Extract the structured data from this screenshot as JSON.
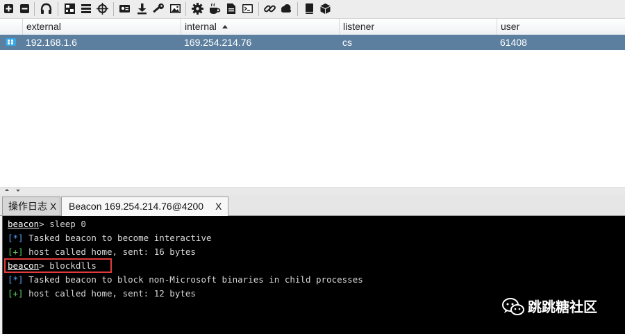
{
  "toolbar": {
    "buttons": [
      {
        "name": "new-connection-icon"
      },
      {
        "name": "disconnect-icon"
      },
      {
        "name": "listeners-headphones-icon"
      },
      {
        "name": "pivot-graph-icon"
      },
      {
        "name": "session-table-icon"
      },
      {
        "name": "targets-crosshair-icon"
      },
      {
        "name": "credentials-icon"
      },
      {
        "name": "downloads-icon"
      },
      {
        "name": "keystrokes-key-icon"
      },
      {
        "name": "screenshots-image-icon"
      },
      {
        "name": "settings-gear-icon"
      },
      {
        "name": "web-drive-by-cup-icon"
      },
      {
        "name": "document-icon"
      },
      {
        "name": "script-console-icon"
      },
      {
        "name": "link-icon"
      },
      {
        "name": "cloud-icon"
      },
      {
        "name": "help-book-icon"
      },
      {
        "name": "about-cube-icon"
      }
    ]
  },
  "table": {
    "columns": [
      {
        "label": "external"
      },
      {
        "label": "internal"
      },
      {
        "label": "listener"
      },
      {
        "label": "user"
      }
    ],
    "rows": [
      {
        "os": "windows-icon",
        "external": "192.168.1.6",
        "internal": "169.254.214.76",
        "listener": "cs",
        "user": "61408"
      }
    ]
  },
  "tabs": [
    {
      "label": "操作日志",
      "close": "X"
    },
    {
      "label": "Beacon 169.254.214.76@4200",
      "close": "X"
    }
  ],
  "console": {
    "lines": [
      {
        "prompt": "beacon",
        "text": "> sleep 0"
      },
      {
        "marker": "[*]",
        "text": " Tasked beacon to become interactive"
      },
      {
        "marker": "[+]",
        "text": " host called home, sent: 16 bytes"
      },
      {
        "prompt": "beacon",
        "text": "> blockdlls"
      },
      {
        "marker": "[*]",
        "text": " Tasked beacon to block non-Microsoft binaries in child processes"
      },
      {
        "marker": "[+]",
        "text": " host called home, sent: 12 bytes"
      }
    ]
  },
  "watermark": {
    "text": "跳跳糖社区"
  },
  "colors": {
    "selected_row": "#5c7f9f",
    "console_bg": "#000000",
    "highlight": "#e23b3b",
    "info_marker": "#5aa9ff",
    "ok_marker": "#5fd35f"
  }
}
